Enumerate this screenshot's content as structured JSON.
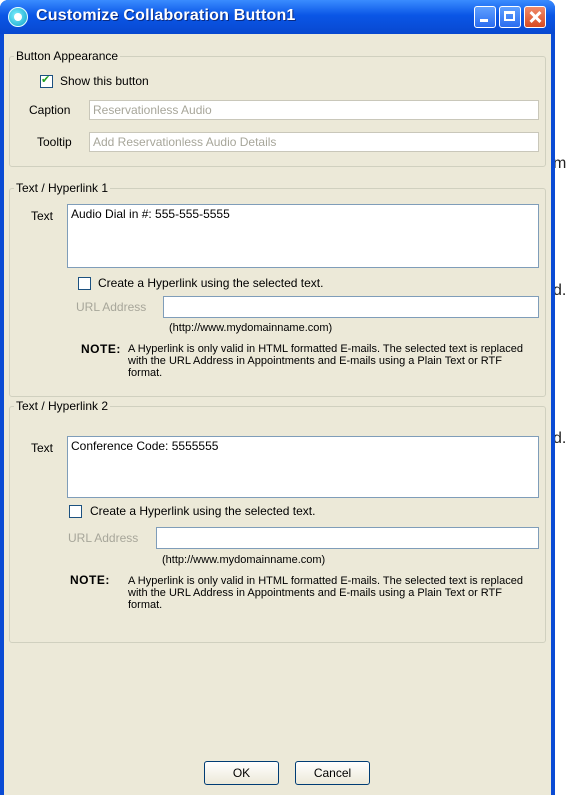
{
  "background_fragments": [
    "m",
    "d.",
    "d."
  ],
  "window": {
    "title": "Customize Collaboration Button1"
  },
  "button_appearance": {
    "legend": "Button Appearance",
    "show_label": "Show this button",
    "show_checked": true,
    "caption_label": "Caption",
    "caption_value": "Reservationless Audio",
    "tooltip_label": "Tooltip",
    "tooltip_value": "Add Reservationless Audio Details"
  },
  "hyperlink1": {
    "legend": "Text / Hyperlink 1",
    "text_label": "Text",
    "text_value": "Audio Dial in #: 555-555-5555",
    "create_label": "Create a Hyperlink using the selected text.",
    "url_label": "URL Address",
    "url_value": "",
    "url_example": "(http://www.mydomainname.com)",
    "note_title": "NOTE:",
    "note_text": "A Hyperlink is only valid in HTML formatted E-mails. The selected text is replaced with the URL Address in Appointments and E-mails using a Plain Text or RTF format."
  },
  "hyperlink2": {
    "legend": "Text / Hyperlink 2",
    "text_label": "Text",
    "text_value": "Conference Code: 5555555",
    "create_label": "Create a Hyperlink using the selected text.",
    "url_label": "URL Address",
    "url_value": "",
    "url_example": "(http://www.mydomainname.com)",
    "note_title": "NOTE:",
    "note_text": "A Hyperlink is only valid in HTML formatted E-mails. The selected text is replaced with the URL Address in Appointments and E-mails using a Plain Text or RTF format."
  },
  "buttons": {
    "ok": "OK",
    "cancel": "Cancel"
  }
}
